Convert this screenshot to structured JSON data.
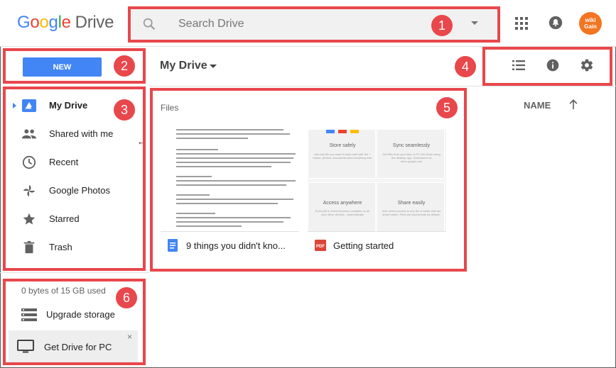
{
  "brand": {
    "letters": [
      "G",
      "o",
      "o",
      "g",
      "l",
      "e"
    ],
    "product": "Drive"
  },
  "search": {
    "placeholder": "Search Drive"
  },
  "user": {
    "avatar_text_line1": "wiki",
    "avatar_text_line2": "Gain"
  },
  "toolbar": {
    "new_label": "NEW",
    "location_title": "My Drive"
  },
  "sidebar": {
    "items": [
      {
        "label": "My Drive",
        "icon": "my-drive-icon",
        "active": true
      },
      {
        "label": "Shared with me",
        "icon": "shared-people-icon",
        "active": false
      },
      {
        "label": "Recent",
        "icon": "clock-icon",
        "active": false
      },
      {
        "label": "Google Photos",
        "icon": "pinwheel-icon",
        "active": false
      },
      {
        "label": "Starred",
        "icon": "star-icon",
        "active": false
      },
      {
        "label": "Trash",
        "icon": "trash-icon",
        "active": false
      }
    ],
    "storage": "0 bytes of 15 GB used",
    "upgrade_label": "Upgrade storage",
    "get_drive_label": "Get Drive for PC",
    "close_glyph": "×"
  },
  "main": {
    "section_label": "Files",
    "sort_column": "NAME",
    "files": [
      {
        "name": "9 things you didn't kno...",
        "type": "doc"
      },
      {
        "name": "Getting started",
        "type": "pdf"
      }
    ],
    "getting_started_thumb": {
      "cells": [
        {
          "title": "Store safely",
          "desc": "Add any file you want to keep safe with the + button: photos, documents and everything else"
        },
        {
          "title": "Sync seamlessly",
          "desc": "Get files from your Mac or PC into Drive using the desktop app. Download it at drive.google.com"
        },
        {
          "title": "Access anywhere",
          "desc": "Every file in Drive becomes available on all your other devices - automatically"
        },
        {
          "title": "Share easily",
          "desc": "Give others access to any file or folder with the share button. Files are kept private by default."
        }
      ]
    }
  },
  "annotations": [
    {
      "number": "1"
    },
    {
      "number": "2"
    },
    {
      "number": "3"
    },
    {
      "number": "4"
    },
    {
      "number": "5"
    },
    {
      "number": "6"
    }
  ],
  "colors": {
    "accent_blue": "#4285f4",
    "annotation_red": "#e8474c",
    "avatar_orange": "#f37521",
    "pdf_red": "#db4437"
  }
}
